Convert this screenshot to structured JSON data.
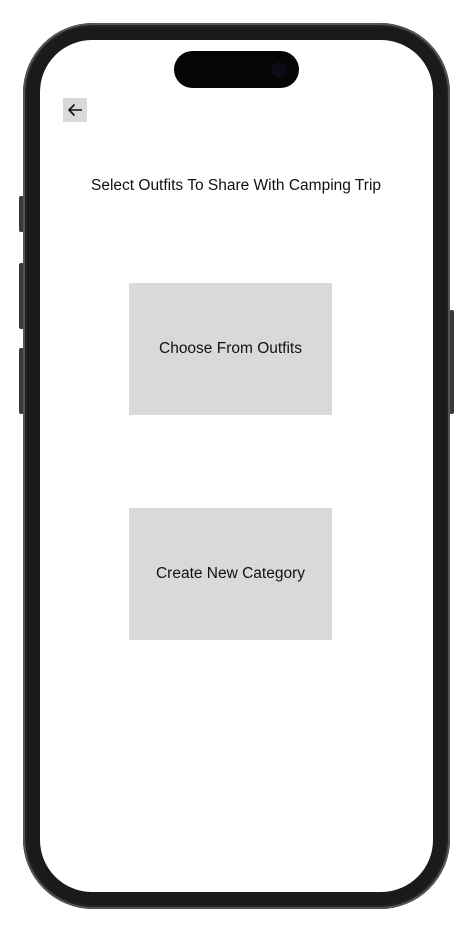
{
  "header": {
    "back_icon": "arrow-left-icon",
    "title": "Select Outfits To Share With Camping Trip"
  },
  "actions": [
    {
      "label": "Choose From Outfits"
    },
    {
      "label": "Create New Category"
    }
  ],
  "colors": {
    "button_bg": "#d9d9d9",
    "frame": "#1a1a1a"
  }
}
